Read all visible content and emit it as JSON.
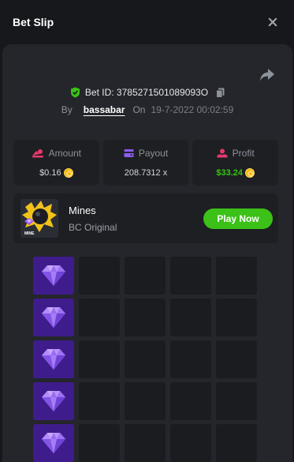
{
  "header": {
    "title": "Bet Slip"
  },
  "bet": {
    "id_label": "Bet ID: 3785271501089093O",
    "by_label": "By",
    "username": "bassabar",
    "on_label": "On",
    "datetime": "19-7-2022 00:02:59"
  },
  "stats": {
    "amount": {
      "label": "Amount",
      "value": "$0.16"
    },
    "payout": {
      "label": "Payout",
      "value": "208.7312 x"
    },
    "profit": {
      "label": "Profit",
      "value": "$33.24"
    }
  },
  "game": {
    "name": "Mines",
    "provider": "BC Original",
    "thumb_text": "MINE",
    "play_label": "Play Now"
  },
  "board": {
    "columns": 5,
    "rows": [
      [
        "gem",
        "empty",
        "empty",
        "empty",
        "empty"
      ],
      [
        "gem",
        "empty",
        "empty",
        "empty",
        "empty"
      ],
      [
        "gem",
        "empty",
        "empty",
        "empty",
        "empty"
      ],
      [
        "gem",
        "empty",
        "empty",
        "empty",
        "empty"
      ],
      [
        "gem",
        "empty",
        "empty",
        "empty",
        "empty"
      ]
    ]
  },
  "icons": {
    "close": "close-icon",
    "share": "share-icon",
    "verified": "shield-check-icon",
    "copy": "copy-icon",
    "amount": "chips-icon",
    "payout": "wallet-icon",
    "profit": "coins-hand-icon",
    "currency": "coin-icon",
    "gem": "diamond-icon"
  },
  "colors": {
    "accent_green": "#3bc117",
    "gem_tile": "#3f1c8c",
    "gem": "#a77cf5",
    "amount_icon": "#e8396c",
    "payout_icon": "#8c5cf0",
    "profit_icon": "#e8396c"
  }
}
